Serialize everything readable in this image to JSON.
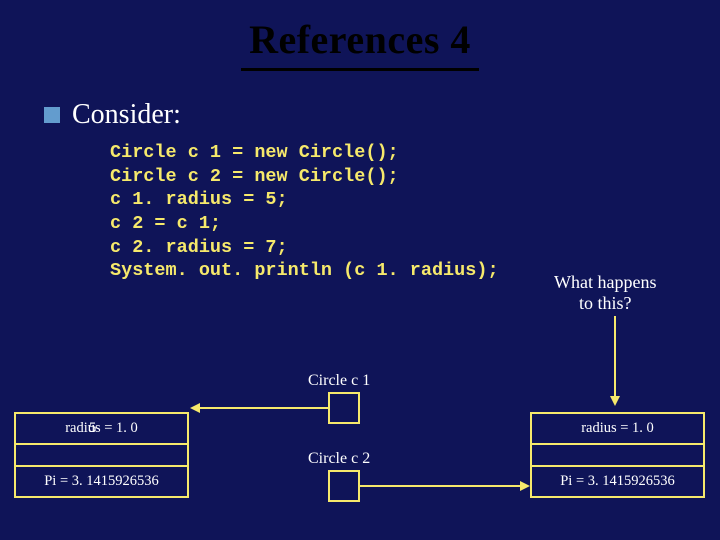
{
  "title": "References 4",
  "consider": "Consider:",
  "code": "Circle c 1 = new Circle();\nCircle c 2 = new Circle();\nc 1. radius = 5;\nc 2 = c 1;\nc 2. radius = 7;\nSystem. out. println (c 1. radius);",
  "what_happens_l1": "What happens",
  "what_happens_l2": "to this?",
  "labels": {
    "c1": "Circle c 1",
    "c2": "Circle c 2"
  },
  "obj_left": {
    "radius": "radius = 1. 0",
    "radius_overlay": "5",
    "pi": "Pi = 3. 1415926536"
  },
  "obj_right": {
    "radius": "radius = 1. 0",
    "pi": "Pi = 3. 1415926536"
  }
}
